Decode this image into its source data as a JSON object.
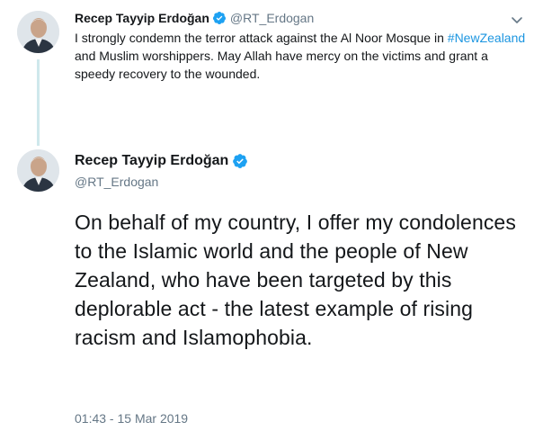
{
  "colors": {
    "verified_badge": "#1da1f2",
    "hashtag": "#1b95e0",
    "secondary_text": "#657786",
    "thread_line": "#cfe8ec"
  },
  "parent_tweet": {
    "author_name": "Recep Tayyip Erdoğan",
    "author_handle": "@RT_Erdogan",
    "verified": true,
    "text_before_hashtag": "I strongly condemn the terror attack against the Al Noor Mosque in ",
    "hashtag": "#NewZealand",
    "text_after_hashtag": " and Muslim worshippers. May Allah have mercy on the victims and grant a speedy recovery to the wounded.",
    "menu_icon": "chevron-down-icon"
  },
  "focused_tweet": {
    "author_name": "Recep Tayyip Erdoğan",
    "author_handle": "@RT_Erdogan",
    "verified": true,
    "text": "On behalf of my country, I offer my condolences to the Islamic world and the people of New Zealand, who have been targeted by this deplorable act - the latest example of rising racism and Islamophobia.",
    "timestamp": "01:43 - 15 Mar 2019"
  }
}
